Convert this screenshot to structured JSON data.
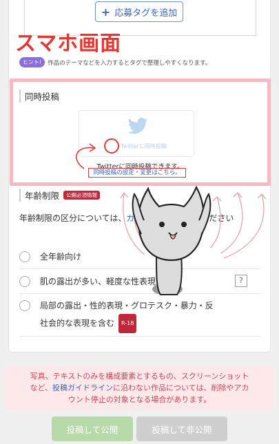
{
  "tag_section": {
    "add_tag_label": "応募タグを追加",
    "hint_badge": "ヒント!",
    "hint_text": "作品のテーマなどを入力するとタグで整理しやすくなります。"
  },
  "overlay_title": "スマホ画面",
  "simul_post": {
    "label": "同時投稿",
    "twitter_label": "Twitterに同時投稿",
    "note": "Twitterに同時投稿できます。",
    "link": "同時投稿の設定・変更はこちら。"
  },
  "age_restriction": {
    "label": "年齢制限",
    "required_badge": "公開必須情報",
    "desc_prefix": "年齢制限の区分については、",
    "desc_link": "ガイドライン",
    "desc_suffix": "をご覧ください",
    "options": [
      {
        "label": "全年齢向け"
      },
      {
        "label": "肌の露出が多い、軽度な性表現"
      },
      {
        "label": "局部の露出・性的表現・グロテスク・暴力・反",
        "label2": "社会的な表現を含む",
        "badge": "R-18"
      }
    ]
  },
  "warning": {
    "line1": "写真、テキストのみを構成要素とするもの、スクリーンショット",
    "line2_a": "など、",
    "line2_link": "投稿ガイドライン",
    "line2_b": "に沿わない作品については、削除やアカ",
    "line3": "ウント停止の対象となる場合があります。"
  },
  "buttons": {
    "publish": "投稿して公開",
    "private": "投稿して非公開"
  },
  "colors": {
    "accent_red": "#e8342f",
    "pink_frame": "#f6b9c2",
    "link_blue": "#3a65c0",
    "publish_green": "#b8d9a9"
  }
}
